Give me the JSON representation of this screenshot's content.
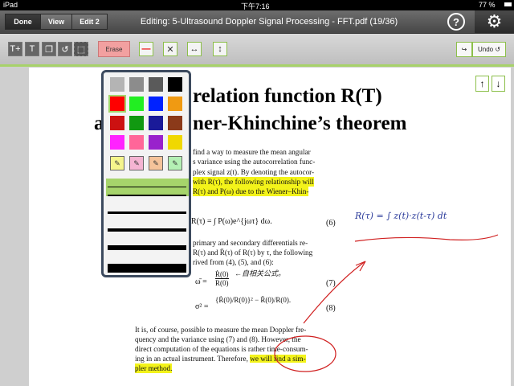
{
  "status": {
    "device": "iPad",
    "time": "下午7:16",
    "battery": "77 %"
  },
  "titlebar": {
    "tabs": [
      {
        "label": "Done"
      },
      {
        "label": "View"
      },
      {
        "label": "Edit 2"
      }
    ],
    "title": "Editing: 5-Ultrasound Doppler Signal Processing - FFT.pdf (19/36)",
    "help_label": "?"
  },
  "toolbar": {
    "tools": [
      {
        "icon": "T+"
      },
      {
        "icon": "T"
      }
    ],
    "erase_label": "Erase",
    "undo_label": "Undo",
    "redo_label": "Redo"
  },
  "palette": {
    "colors": [
      "#b4b4b4",
      "#8c8c8c",
      "#5a5a5a",
      "#000000",
      "#ff0000",
      "#22ee22",
      "#0022ff",
      "#f09a12",
      "#cc1111",
      "#119911",
      "#1a1a99",
      "#8b3a1a",
      "#ff22ff",
      "#ff6699",
      "#9922cc",
      "#f0d800"
    ],
    "highlighters": [
      "#f5f58c",
      "#f5b4d2",
      "#f5c39a",
      "#b4f0b4"
    ],
    "line_widths": [
      1,
      2,
      3,
      4,
      6,
      11
    ]
  },
  "document": {
    "heading_line1": "relation function R(T)",
    "heading_line2": "ner-Khinchine’s theorem",
    "heading_a": "a",
    "para1": [
      "find a way to measure the mean angular",
      "s variance using the autocorrelation func-",
      "plex signal z(t). By denoting the autocor-",
      "with R(τ), the following relationship will",
      "R(τ) and P(ω) due to the Wiener–Khin-"
    ],
    "eq6": "R(τ) = ∫ P(ω)e^{jωτ} dω.",
    "eq6_num": "(6)",
    "para2": [
      "primary and secondary differentials re-",
      "R(τ) and R̈(τ) of R(τ) by τ, the following",
      "rived from (4), (5), and (6):"
    ],
    "eq7_lhs": "ω̄ =",
    "eq7_num": "(7)",
    "eq8_lhs": "σ² =",
    "eq8_num": "(8)",
    "para3": [
      "It is, of course, possible to measure the mean Doppler fre-",
      "quency and the variance using (7) and (8). However, the",
      "direct computation of the equations is rather time-consum-",
      "ing in an actual instrument. Therefore, ",
      "we will find a sim-",
      "pler method."
    ],
    "handwriting_right": "R(τ) = ∫ z(t)·z(t-τ) dt",
    "handwriting_eq7": "←自相关公式。"
  },
  "accent_color": "#a7d26a"
}
